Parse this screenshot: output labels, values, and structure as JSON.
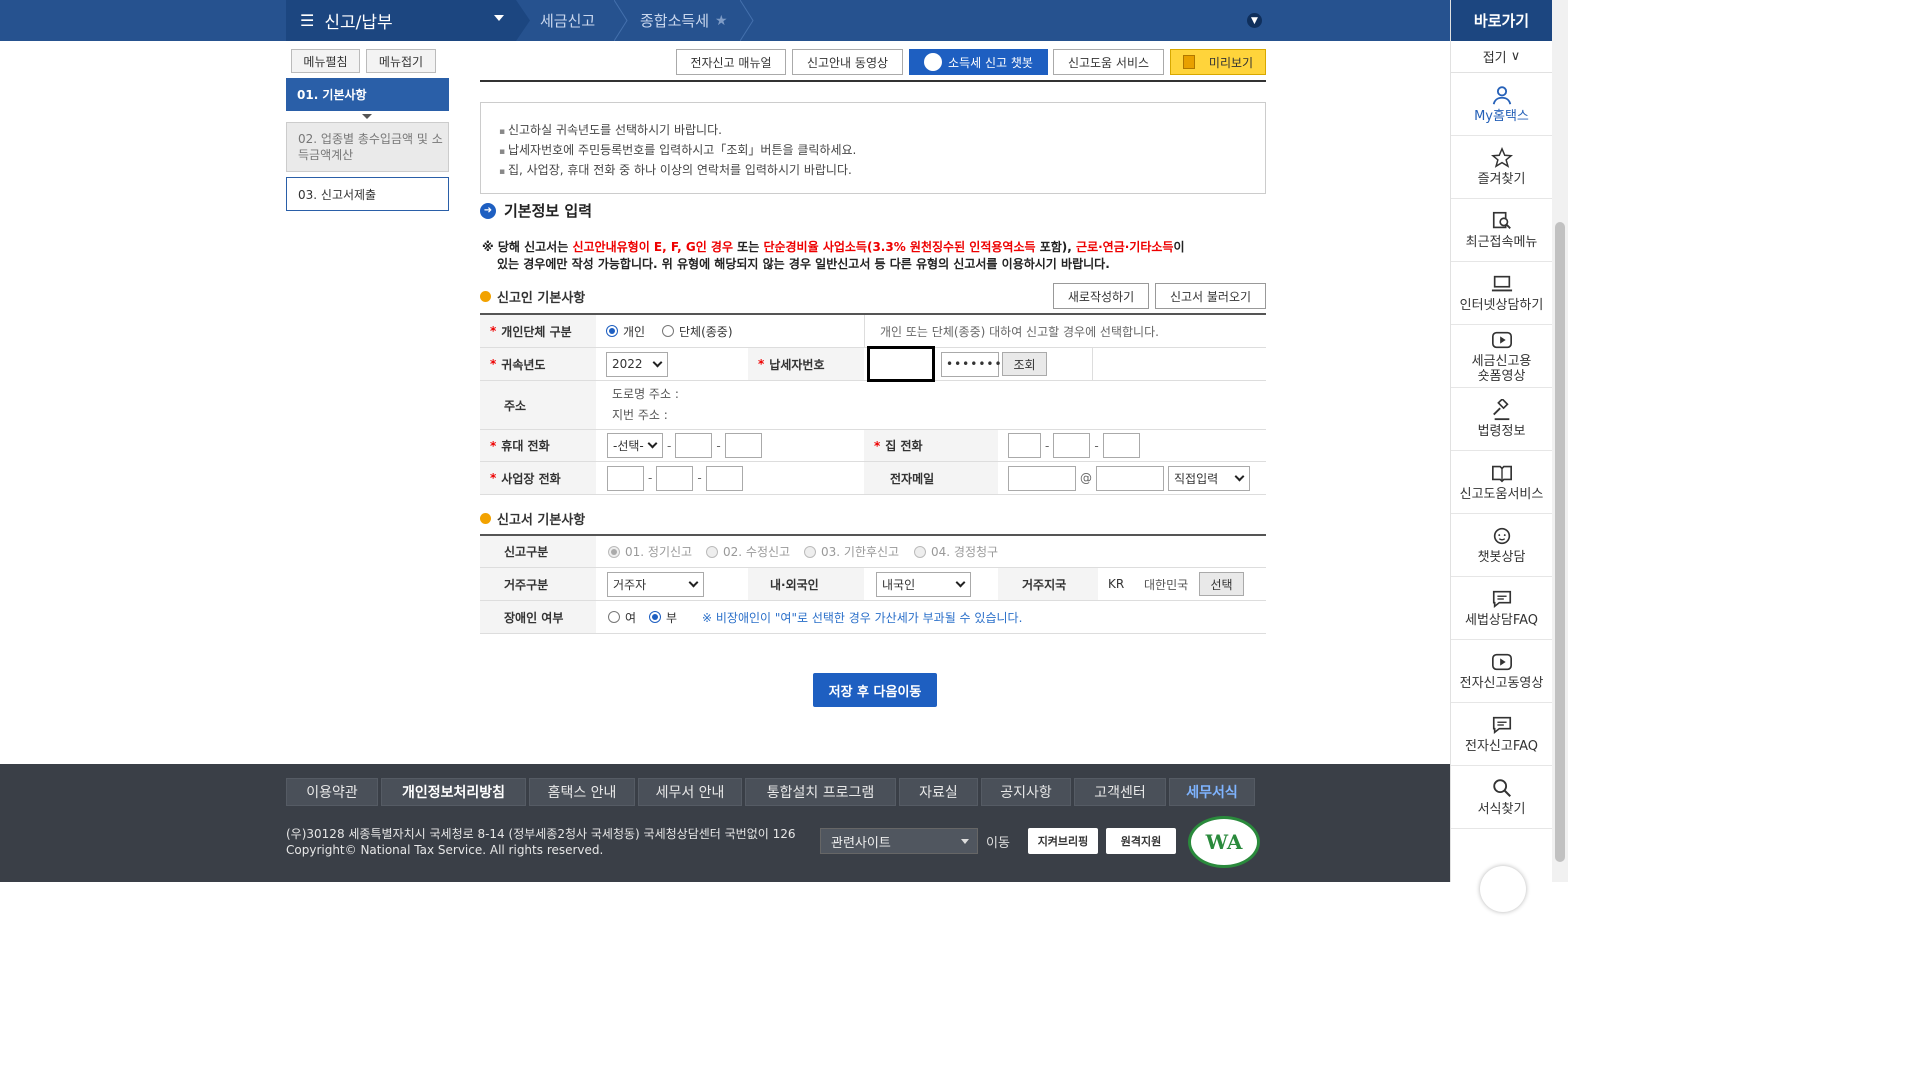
{
  "topbar": {
    "menu": "신고/납부",
    "crumbs": [
      "세금신고",
      "종합소득세"
    ]
  },
  "quick": {
    "title": "바로가기",
    "fold": "접기",
    "items": [
      {
        "label": "My홈택스",
        "icon": "user-icon"
      },
      {
        "label": "즐겨찾기",
        "icon": "star-icon"
      },
      {
        "label": "최근접속메뉴",
        "icon": "search-doc-icon"
      },
      {
        "label": "인터넷상담하기",
        "icon": "laptop-icon"
      },
      {
        "label": "세금신고용\n숏폼영상",
        "icon": "play-icon"
      },
      {
        "label": "법령정보",
        "icon": "gavel-icon"
      },
      {
        "label": "신고도움서비스",
        "icon": "book-icon"
      },
      {
        "label": "챗봇상담",
        "icon": "headset-icon"
      },
      {
        "label": "세법상담FAQ",
        "icon": "chat-icon"
      },
      {
        "label": "전자신고동영상",
        "icon": "play-icon"
      },
      {
        "label": "전자신고FAQ",
        "icon": "chat-icon"
      },
      {
        "label": "서식찾기",
        "icon": "search-icon"
      }
    ]
  },
  "leftnav": {
    "expand": "메뉴펼침",
    "collapse": "메뉴접기",
    "steps": [
      "01. 기본사항",
      "02. 업종별 총수입금액 및 소득금액계산",
      "03. 신고서제출"
    ]
  },
  "toolbar": {
    "manual": "전자신고 매뉴얼",
    "video": "신고안내 동영상",
    "chatbot": "소득세 신고 챗봇",
    "help": "신고도움 서비스",
    "preview": "미리보기"
  },
  "notice": [
    "신고하실 귀속년도를 선택하시기 바랍니다.",
    "납세자번호에 주민등록번호를 입력하시고「조회」버튼을 클릭하세요.",
    "집, 사업장, 휴대 전화 중 하나 이상의 연락처를 입력하시기 바랍니다."
  ],
  "section_title": "기본정보 입력",
  "warning": {
    "p1": "※ 당해 신고서는 ",
    "r1": "신고안내유형이 E, F, G인 경우",
    "p2": " 또는 ",
    "r2": "단순경비율 사업소득(3.3% 원천징수된 인적용역소득",
    "p3": " 포함), ",
    "r3": "근로·연금·기타소득",
    "p4": "이",
    "line2": "있는 경우에만 작성 가능합니다. 위 유형에 해당되지 않는 경우 일반신고서 등 다른 유형의 신고서를 이용하시기 바랍니다."
  },
  "basic": {
    "title": "신고인 기본사항",
    "new_btn": "새로작성하기",
    "load_btn": "신고서 불러오기",
    "type_label": "개인단체 구분",
    "type_opt1": "개인",
    "type_opt2": "단체(종중)",
    "type_hint": "개인 또는 단체(종중) 대하여 신고할 경우에 선택합니다.",
    "year_label": "귀속년도",
    "year_value": "2022",
    "taxid_label": "납세자번호",
    "taxid_masked": "•••••••",
    "lookup_btn": "조회",
    "addr_label": "주소",
    "road_addr": "도로명 주소 :",
    "lot_addr": "지번 주소 :",
    "mobile_label": "휴대 전화",
    "mobile_select": "-선택-",
    "home_label": "집 전화",
    "biz_label": "사업장 전화",
    "email_label": "전자메일",
    "email_at": "@",
    "email_domain": "직접입력"
  },
  "report": {
    "title": "신고서 기본사항",
    "kind_label": "신고구분",
    "kinds": [
      "01. 정기신고",
      "02. 수정신고",
      "03. 기한후신고",
      "04. 경정청구"
    ],
    "resident_label": "거주구분",
    "resident_value": "거주자",
    "nation_label": "내·외국인",
    "nation_value": "내국인",
    "country_label": "거주지국",
    "country_code": "KR",
    "country_name": "대한민국",
    "country_btn": "선택",
    "disabled_label": "장애인 여부",
    "dis_yes": "여",
    "dis_no": "부",
    "dis_note": "※ 비장애인이 \"여\"로 선택한 경우 가산세가 부과될 수 있습니다."
  },
  "save_btn": "저장 후 다음이동",
  "footer": {
    "links": [
      "이용약관",
      "개인정보처리방침",
      "홈택스 안내",
      "세무서 안내",
      "통합설치 프로그램",
      "자료실",
      "공지사항",
      "고객센터",
      "세무서식"
    ],
    "addr1": "(우)30128 세종특별자치시 국세청로 8-14 (정부세종2청사 국세청동) 국세청상담센터 국번없이 126",
    "addr2": "Copyright© National Tax Service. All rights reserved.",
    "related": "관련사이트",
    "move": "이동",
    "btn1": "지켜브리핑",
    "btn2": "원격지원",
    "wa": "WA"
  },
  "colors": {
    "primary": "#1e5fc1",
    "navy": "#26528f",
    "footer": "#3a3f47",
    "required": "#e00000"
  }
}
